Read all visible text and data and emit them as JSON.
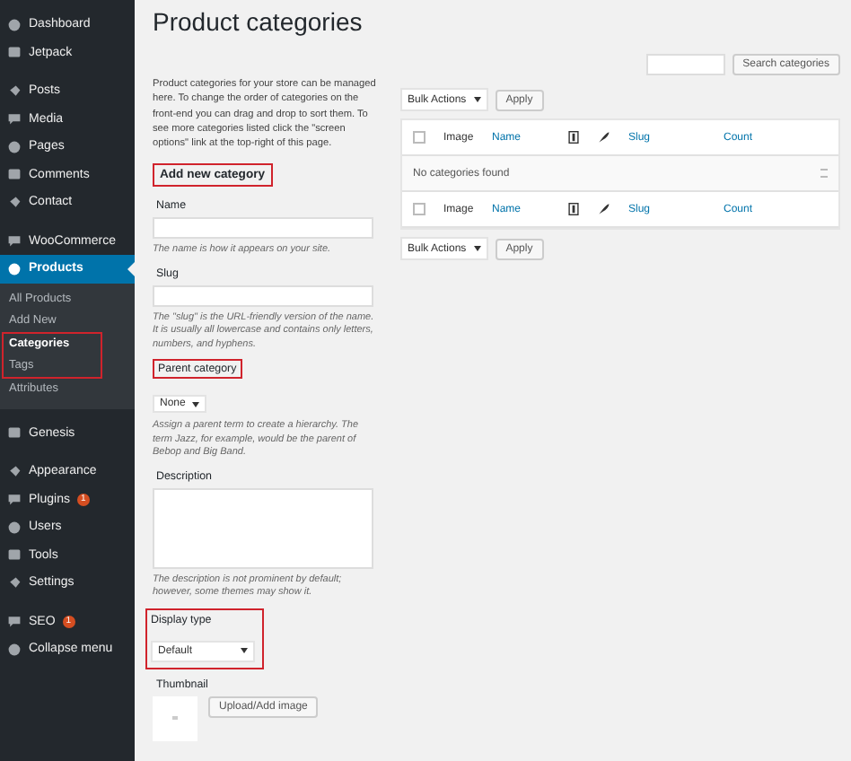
{
  "sidebar": {
    "sections": [
      [
        {
          "label": "Dashboard",
          "selected": false
        },
        {
          "label": "Jetpack",
          "selected": false
        }
      ],
      [
        {
          "label": "Posts",
          "selected": false
        },
        {
          "label": "Media",
          "selected": false
        },
        {
          "label": "Pages",
          "selected": false
        },
        {
          "label": "Comments",
          "selected": false
        },
        {
          "label": "Contact",
          "selected": false
        }
      ],
      [
        {
          "label": "WooCommerce",
          "selected": false
        },
        {
          "label": "Products",
          "selected": true,
          "children": [
            {
              "label": "All Products",
              "selected": false,
              "highlighted": false
            },
            {
              "label": "Add New",
              "selected": false,
              "highlighted": false
            },
            {
              "label": "Categories",
              "selected": true,
              "highlighted": true
            },
            {
              "label": "Tags",
              "selected": false,
              "highlighted": true
            },
            {
              "label": "Attributes",
              "selected": false,
              "highlighted": false
            }
          ]
        }
      ],
      [
        {
          "label": "Genesis",
          "selected": false
        }
      ],
      [
        {
          "label": "Appearance",
          "selected": false
        },
        {
          "label": "Plugins",
          "selected": false,
          "badge": "1"
        },
        {
          "label": "Users",
          "selected": false
        },
        {
          "label": "Tools",
          "selected": false
        },
        {
          "label": "Settings",
          "selected": false
        }
      ],
      [
        {
          "label": "SEO",
          "selected": false,
          "badge": "1"
        },
        {
          "label": "Collapse menu",
          "selected": false
        }
      ]
    ]
  },
  "page": {
    "title": "Product categories"
  },
  "intro": "Product categories for your store can be managed here. To change the order of categories on the front-end you can drag and drop to sort them. To see more categories listed click the \"screen options\" link at the top-right of this page.",
  "form": {
    "heading": "Add new category",
    "heading_highlighted": true,
    "fields": [
      {
        "kind": "text",
        "label": "Name",
        "highlighted": false,
        "hint": "The name is how it appears on your site."
      },
      {
        "kind": "text",
        "label": "Slug",
        "highlighted": false,
        "hint": "The \"slug\" is the URL-friendly version of the name. It is usually all lowercase and contains only letters, numbers, and hyphens."
      },
      {
        "kind": "select",
        "label": "Parent category",
        "highlighted": true,
        "value": "None",
        "hint": "Assign a parent term to create a hierarchy. The term Jazz, for example, would be the parent of Bebop and Big Band."
      },
      {
        "kind": "textarea",
        "label": "Description",
        "highlighted": false,
        "hint": "The description is not prominent by default; however, some themes may show it."
      },
      {
        "kind": "wideselect",
        "label": "Display type",
        "highlighted": true,
        "value": "Default"
      },
      {
        "kind": "image",
        "label": "Thumbnail",
        "highlighted": false,
        "button": "Upload/Add image"
      }
    ]
  },
  "search": {
    "button": "Search categories"
  },
  "bulk_top": {
    "value": "Bulk Actions",
    "button": "Apply"
  },
  "table": {
    "header": {
      "checked": false,
      "columns": [
        {
          "kind": "check"
        },
        {
          "kind": "text",
          "label": "Image"
        },
        {
          "kind": "link",
          "label": "Name"
        },
        {
          "kind": "thumb"
        },
        {
          "kind": "feather"
        },
        {
          "kind": "link",
          "label": "Slug"
        },
        {
          "kind": "link",
          "label": "Count"
        }
      ]
    },
    "empty": "No categories found",
    "footer": {
      "checked": false,
      "columns": [
        {
          "kind": "check"
        },
        {
          "kind": "text",
          "label": "Image"
        },
        {
          "kind": "link",
          "label": "Name"
        },
        {
          "kind": "thumb"
        },
        {
          "kind": "feather"
        },
        {
          "kind": "link",
          "label": "Slug"
        },
        {
          "kind": "link",
          "label": "Count"
        }
      ]
    }
  },
  "bulk_bottom": {
    "value": "Bulk Actions",
    "button": "Apply"
  }
}
